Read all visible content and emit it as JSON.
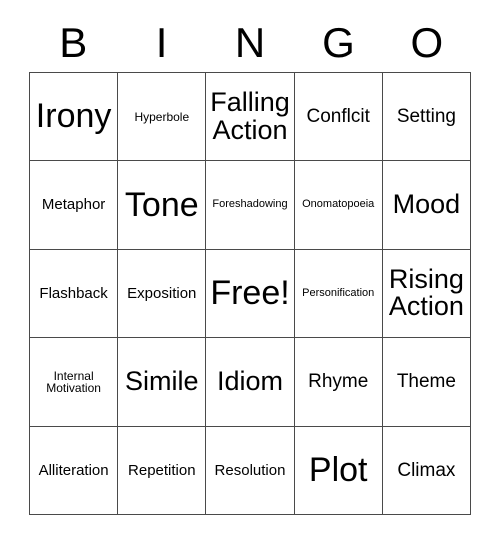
{
  "card": {
    "header_letters": [
      "B",
      "I",
      "N",
      "G",
      "O"
    ],
    "rows": [
      [
        {
          "label": "Irony",
          "size": "xl"
        },
        {
          "label": "Hyperbole",
          "size": "xs"
        },
        {
          "label": "Falling Action",
          "size": "lg"
        },
        {
          "label": "Conflcit",
          "size": "md"
        },
        {
          "label": "Setting",
          "size": "md"
        }
      ],
      [
        {
          "label": "Metaphor",
          "size": "sm"
        },
        {
          "label": "Tone",
          "size": "xl"
        },
        {
          "label": "Foreshadowing",
          "size": "xxs"
        },
        {
          "label": "Onomatopoeia",
          "size": "xxs"
        },
        {
          "label": "Mood",
          "size": "lg"
        }
      ],
      [
        {
          "label": "Flashback",
          "size": "sm"
        },
        {
          "label": "Exposition",
          "size": "sm"
        },
        {
          "label": "Free!",
          "size": "xl"
        },
        {
          "label": "Personification",
          "size": "xxs"
        },
        {
          "label": "Rising Action",
          "size": "lg"
        }
      ],
      [
        {
          "label": "Internal Motivation",
          "size": "xs"
        },
        {
          "label": "Simile",
          "size": "lg"
        },
        {
          "label": "Idiom",
          "size": "lg"
        },
        {
          "label": "Rhyme",
          "size": "md"
        },
        {
          "label": "Theme",
          "size": "md"
        }
      ],
      [
        {
          "label": "Alliteration",
          "size": "sm"
        },
        {
          "label": "Repetition",
          "size": "sm"
        },
        {
          "label": "Resolution",
          "size": "sm"
        },
        {
          "label": "Plot",
          "size": "xl"
        },
        {
          "label": "Climax",
          "size": "md"
        }
      ]
    ]
  },
  "colors": {
    "background": "#ffffff",
    "text": "#000000",
    "grid_line": "#4a4a4a"
  }
}
